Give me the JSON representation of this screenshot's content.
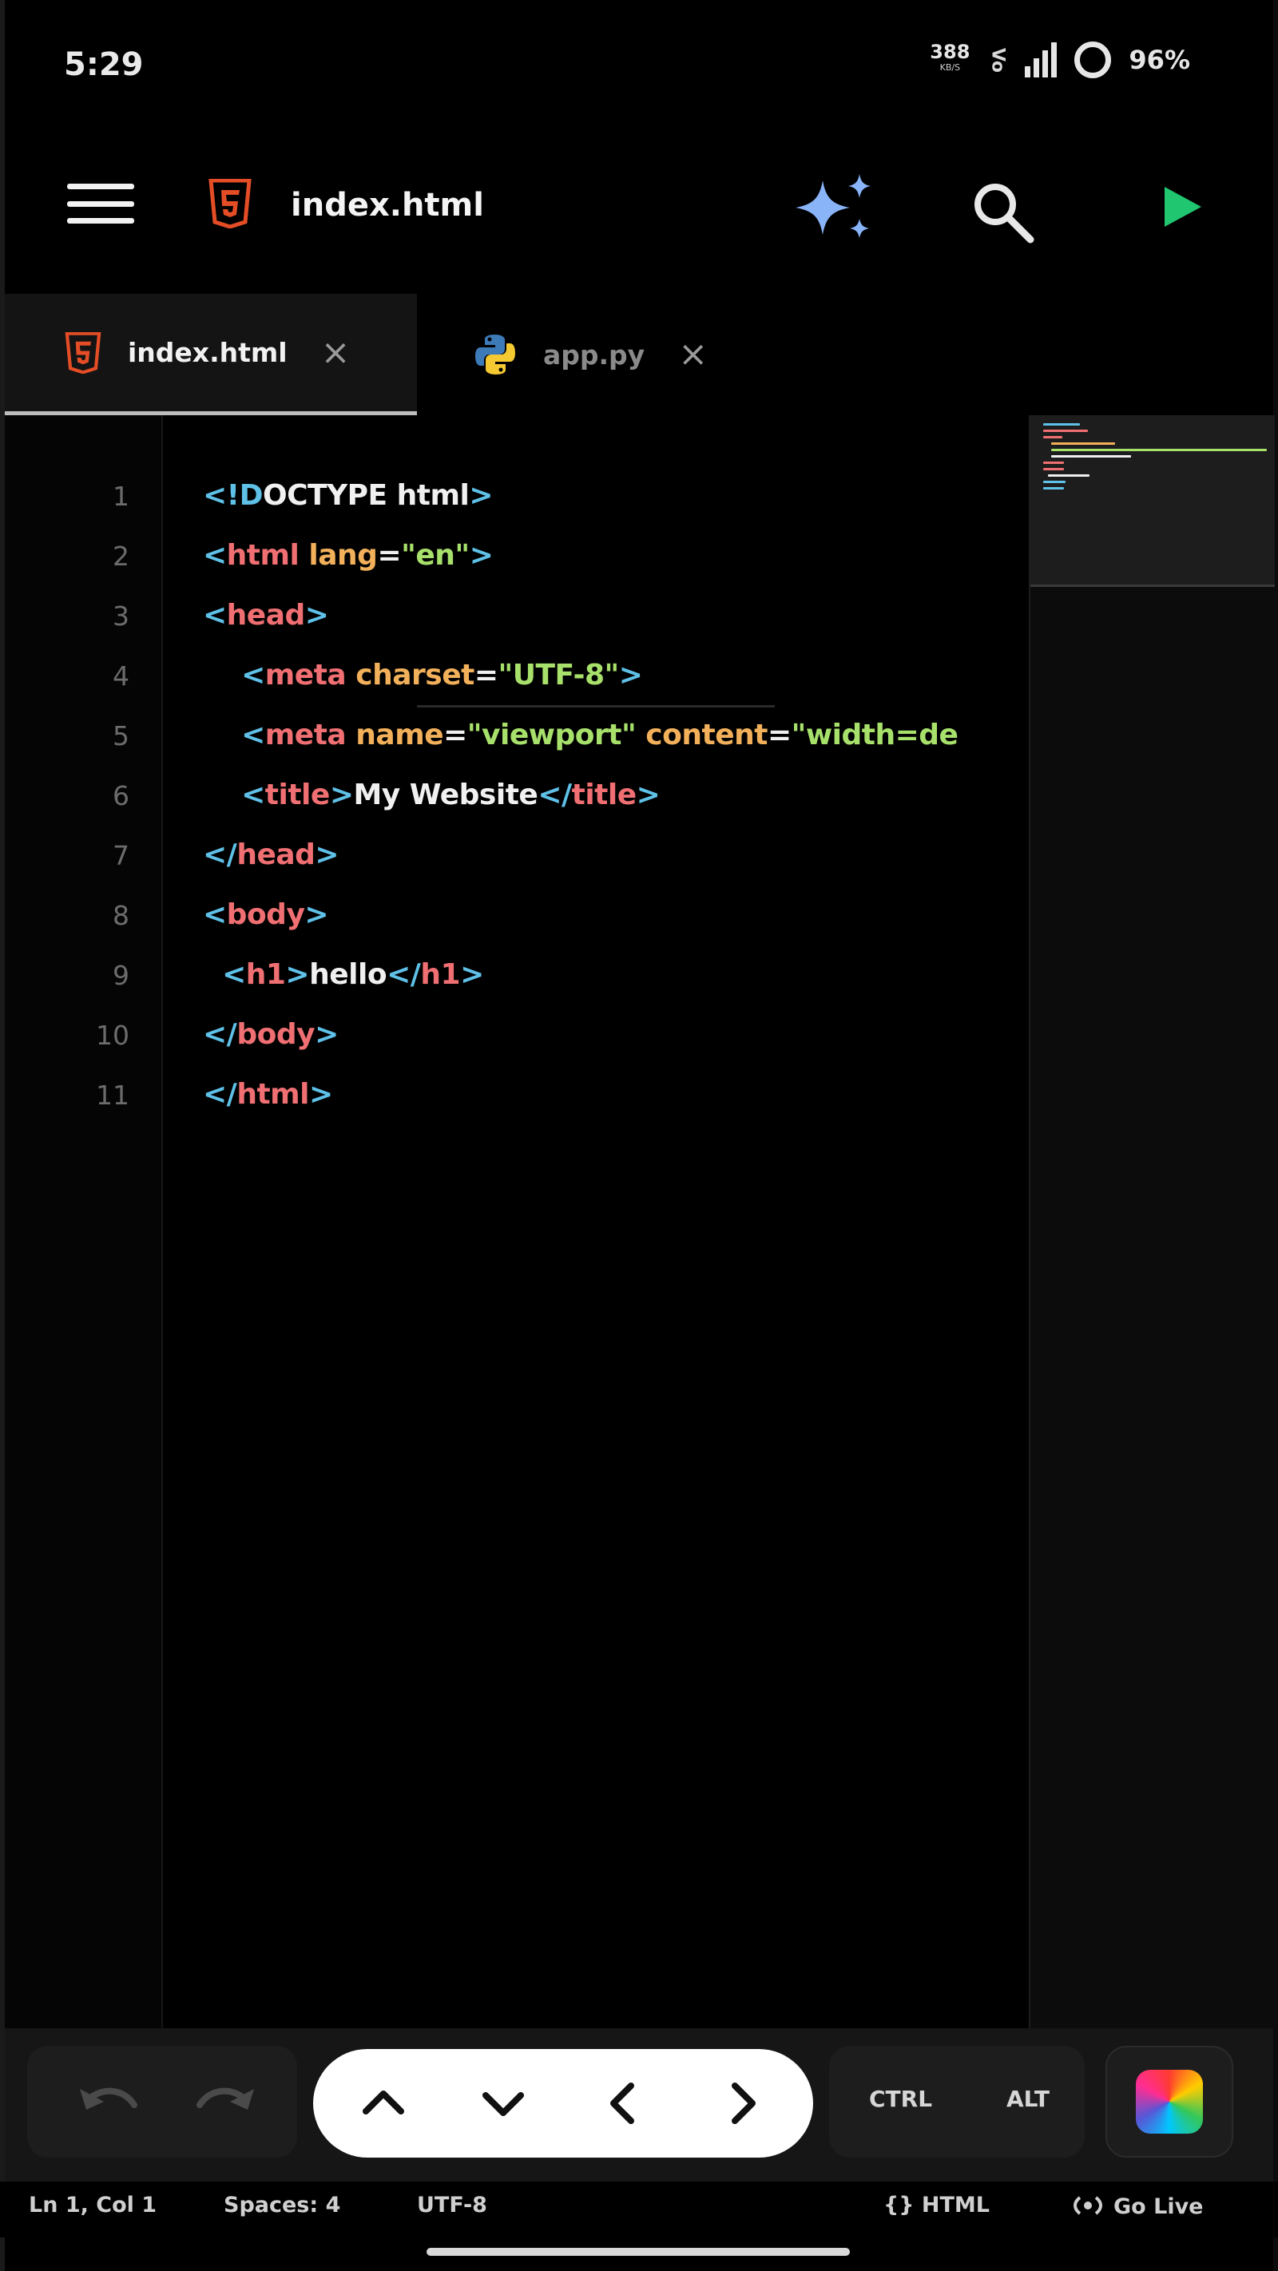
{
  "status_bar": {
    "time": "5:29",
    "net_speed": "388",
    "net_unit": "KB/S",
    "network_type": "Vo",
    "battery": "96%"
  },
  "app_bar": {
    "file_title": "index.html",
    "accent_html": "#e44d26",
    "run_color": "#20c770"
  },
  "tabs": [
    {
      "label": "index.html",
      "icon": "html5-icon",
      "active": true
    },
    {
      "label": "app.py",
      "icon": "python-icon",
      "active": false
    }
  ],
  "editor": {
    "line_numbers": [
      "1",
      "2",
      "3",
      "4",
      "5",
      "6",
      "7",
      "8",
      "9",
      "10",
      "11"
    ],
    "lines": [
      [
        {
          "t": "<!D",
          "c": "tg"
        },
        {
          "t": "OCTYPE html",
          "c": "tx"
        },
        {
          "t": ">",
          "c": "tg"
        }
      ],
      [
        {
          "t": "<",
          "c": "tg"
        },
        {
          "t": "html",
          "c": "tn"
        },
        {
          "t": " lang",
          "c": "at"
        },
        {
          "t": "=",
          "c": "tx"
        },
        {
          "t": "\"en\"",
          "c": "sv"
        },
        {
          "t": ">",
          "c": "tg"
        }
      ],
      [
        {
          "t": "<",
          "c": "tg"
        },
        {
          "t": "head",
          "c": "tn"
        },
        {
          "t": ">",
          "c": "tg"
        }
      ],
      [
        {
          "t": "    <",
          "c": "tg"
        },
        {
          "t": "meta",
          "c": "tn"
        },
        {
          "t": " charset",
          "c": "at"
        },
        {
          "t": "=",
          "c": "tx"
        },
        {
          "t": "\"UTF-8\"",
          "c": "sv"
        },
        {
          "t": ">",
          "c": "tg"
        }
      ],
      [
        {
          "t": "    <",
          "c": "tg"
        },
        {
          "t": "meta",
          "c": "tn"
        },
        {
          "t": " name",
          "c": "at"
        },
        {
          "t": "=",
          "c": "tx"
        },
        {
          "t": "\"viewport\"",
          "c": "sv"
        },
        {
          "t": " content",
          "c": "at"
        },
        {
          "t": "=",
          "c": "tx"
        },
        {
          "t": "\"width=de",
          "c": "sv"
        }
      ],
      [
        {
          "t": "    <",
          "c": "tg"
        },
        {
          "t": "title",
          "c": "tn"
        },
        {
          "t": ">",
          "c": "tg"
        },
        {
          "t": "My Website",
          "c": "tx"
        },
        {
          "t": "</",
          "c": "tg"
        },
        {
          "t": "title",
          "c": "tn"
        },
        {
          "t": ">",
          "c": "tg"
        }
      ],
      [
        {
          "t": "</",
          "c": "tg"
        },
        {
          "t": "head",
          "c": "tn"
        },
        {
          "t": ">",
          "c": "tg"
        }
      ],
      [
        {
          "t": "<",
          "c": "tg"
        },
        {
          "t": "body",
          "c": "tn"
        },
        {
          "t": ">",
          "c": "tg"
        }
      ],
      [
        {
          "t": "  <",
          "c": "tg"
        },
        {
          "t": "h1",
          "c": "tn"
        },
        {
          "t": ">",
          "c": "tg"
        },
        {
          "t": "hello",
          "c": "tx"
        },
        {
          "t": "</",
          "c": "tg"
        },
        {
          "t": "h1",
          "c": "tn"
        },
        {
          "t": ">",
          "c": "tg"
        }
      ],
      [
        {
          "t": "</",
          "c": "tg"
        },
        {
          "t": "body",
          "c": "tn"
        },
        {
          "t": ">",
          "c": "tg"
        }
      ],
      [
        {
          "t": "</",
          "c": "tg"
        },
        {
          "t": "html",
          "c": "tn"
        },
        {
          "t": ">",
          "c": "tg"
        }
      ]
    ]
  },
  "toolbar": {
    "undo_icon": "undo-icon",
    "redo_icon": "redo-icon",
    "arrows": [
      "arrow-up-icon",
      "arrow-down-icon",
      "arrow-left-icon",
      "arrow-right-icon"
    ],
    "ctrl_label": "CTRL",
    "alt_label": "ALT",
    "color_icon": "color-picker-icon"
  },
  "statusline": {
    "cursor": "Ln 1, Col 1",
    "spaces": "Spaces: 4",
    "encoding": "UTF-8",
    "language": "{} HTML",
    "go_live": "Go Live"
  }
}
